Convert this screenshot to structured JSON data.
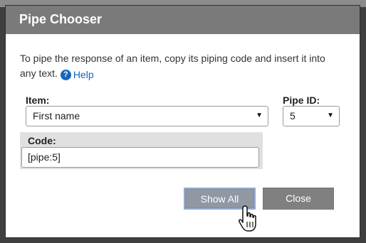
{
  "dialog": {
    "title": "Pipe Chooser",
    "intro_text": "To pipe the response of an item, copy its piping code and insert it into any text.",
    "help_label": "Help",
    "item": {
      "label": "Item:",
      "selected": "First name"
    },
    "pipe_id": {
      "label": "Pipe ID:",
      "selected": "5"
    },
    "code": {
      "label": "Code:",
      "value": "[pipe:5]"
    },
    "buttons": {
      "show_all": "Show All",
      "close": "Close"
    }
  },
  "colors": {
    "titlebar": "#7a7a7a",
    "link": "#1565c0",
    "show_all_bg": "#8f98a3",
    "close_bg": "#808080"
  },
  "icons": [
    "help-icon",
    "dropdown-arrow-icon",
    "hand-pointer-cursor-icon"
  ]
}
